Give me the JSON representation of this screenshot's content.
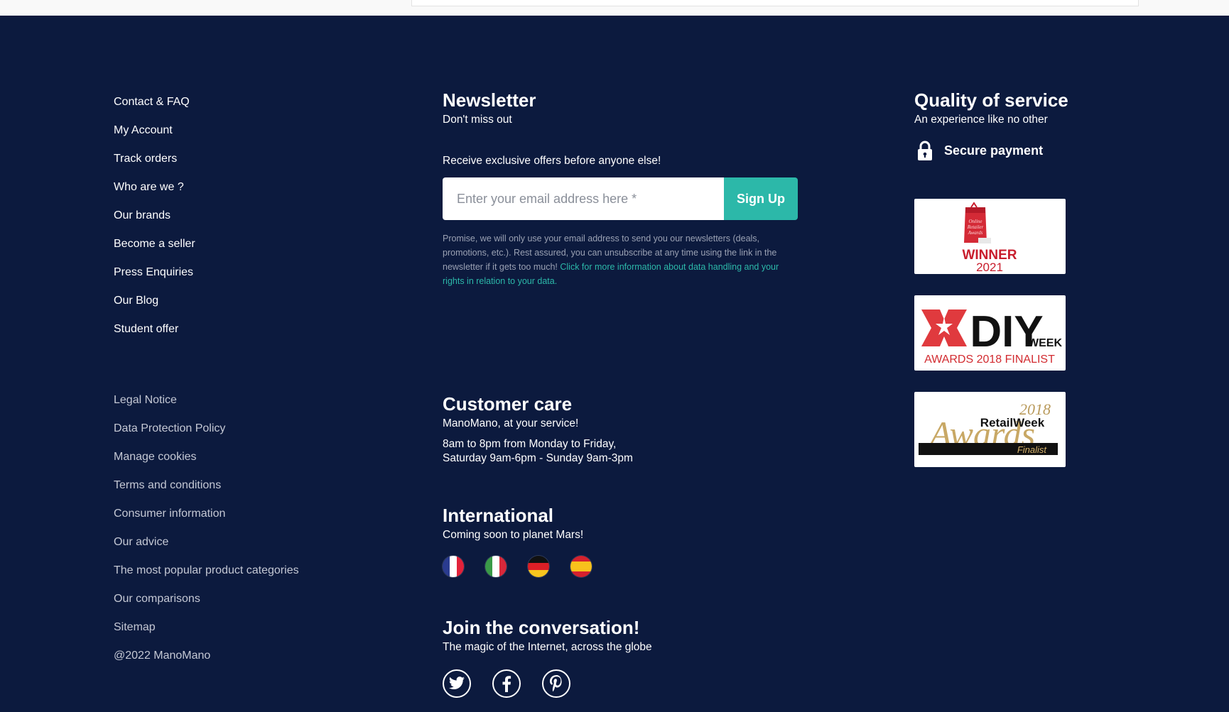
{
  "nav_links": [
    "Contact & FAQ",
    "My Account",
    "Track orders",
    "Who are we ?",
    "Our brands",
    "Become a seller",
    "Press Enquiries",
    "Our Blog",
    "Student offer"
  ],
  "legal_links": [
    "Legal Notice",
    "Data Protection Policy",
    "Manage cookies",
    "Terms and conditions",
    "Consumer information",
    "Our advice",
    "The most popular product categories",
    "Our comparisons",
    "Sitemap",
    "@2022 ManoMano"
  ],
  "newsletter": {
    "title": "Newsletter",
    "subtitle": "Don't miss out",
    "cta": "Receive exclusive offers before anyone else!",
    "placeholder": "Enter your email address here *",
    "button": "Sign Up",
    "promise_text": "Promise, we will only use your email address to send you our newsletters (deals, promotions, etc.). Rest assured, you can unsubscribe at any time using the link in the newsletter if it gets too much! ",
    "promise_link": "Click for more information about data handling and your rights in relation to your data."
  },
  "customer_care": {
    "title": "Customer care",
    "subtitle": "ManoMano, at your service!",
    "hours_line1": "8am to 8pm from Monday to Friday,",
    "hours_line2": "Saturday 9am-6pm - Sunday 9am-3pm"
  },
  "international": {
    "title": "International",
    "subtitle": "Coming soon to planet Mars!",
    "flags": [
      "france-flag-icon",
      "italy-flag-icon",
      "germany-flag-icon",
      "spain-flag-icon"
    ]
  },
  "social": {
    "title": "Join the conversation!",
    "subtitle": "The magic of the Internet, across the globe",
    "icons": [
      "twitter-icon",
      "facebook-icon",
      "pinterest-icon"
    ]
  },
  "quality": {
    "title": "Quality of service",
    "subtitle": "An experience like no other",
    "secure_payment": "Secure payment",
    "awards": {
      "winner_word": "WINNER",
      "winner_year": "2021",
      "diy_main": "DIY",
      "diy_sub": "WEEK",
      "diy_caption": "AWARDS 2018 FINALIST",
      "retail_year": "2018",
      "retail_brand": "RetailWeek",
      "retail_word": "Awards",
      "retail_tag": "Finalist"
    }
  },
  "colors": {
    "background": "#0c1a3e",
    "accent": "#2cb8a9",
    "muted_text": "#c4c8d4"
  }
}
